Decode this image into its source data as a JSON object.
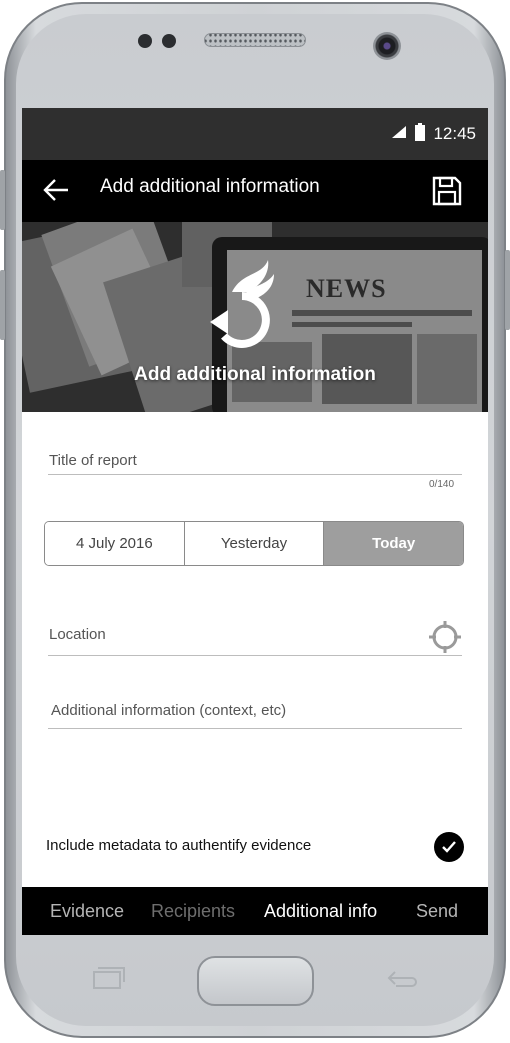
{
  "status_bar": {
    "time": "12:45",
    "signal_icon": "signal-icon",
    "battery_icon": "battery-icon"
  },
  "app_bar": {
    "back_icon": "arrow-left-icon",
    "title": "Add additional information",
    "save_icon": "save-icon"
  },
  "hero": {
    "title": "Add additional information",
    "logo_icon": "app-logo-icon",
    "headline_text": "NEWS"
  },
  "form": {
    "title_field": {
      "placeholder": "Title of report",
      "value": "",
      "counter": "0/140"
    },
    "date_options": [
      {
        "label": "4 July 2016",
        "selected": false
      },
      {
        "label": "Yesterday",
        "selected": false
      },
      {
        "label": "Today",
        "selected": true
      }
    ],
    "location_field": {
      "placeholder": "Location",
      "value": "",
      "icon": "crosshair-icon"
    },
    "additional_field": {
      "placeholder": "Additional information (context, etc)",
      "value": ""
    },
    "metadata": {
      "label": "Include metadata to authentify evidence",
      "checked": true,
      "icon": "check-icon"
    }
  },
  "bottom_nav": {
    "items": [
      {
        "label": "Evidence",
        "state": "done"
      },
      {
        "label": "Recipients",
        "state": "inactive"
      },
      {
        "label": "Additional info",
        "state": "active"
      },
      {
        "label": "Send",
        "state": "pending"
      }
    ]
  },
  "colors": {
    "status_bar": "#2f2f2f",
    "app_bar": "#000000",
    "segment_active": "#9e9e9e",
    "nav_active": "#ffffff",
    "nav_inactive": "#6e6e6e",
    "nav_done": "#b5b5b5"
  }
}
